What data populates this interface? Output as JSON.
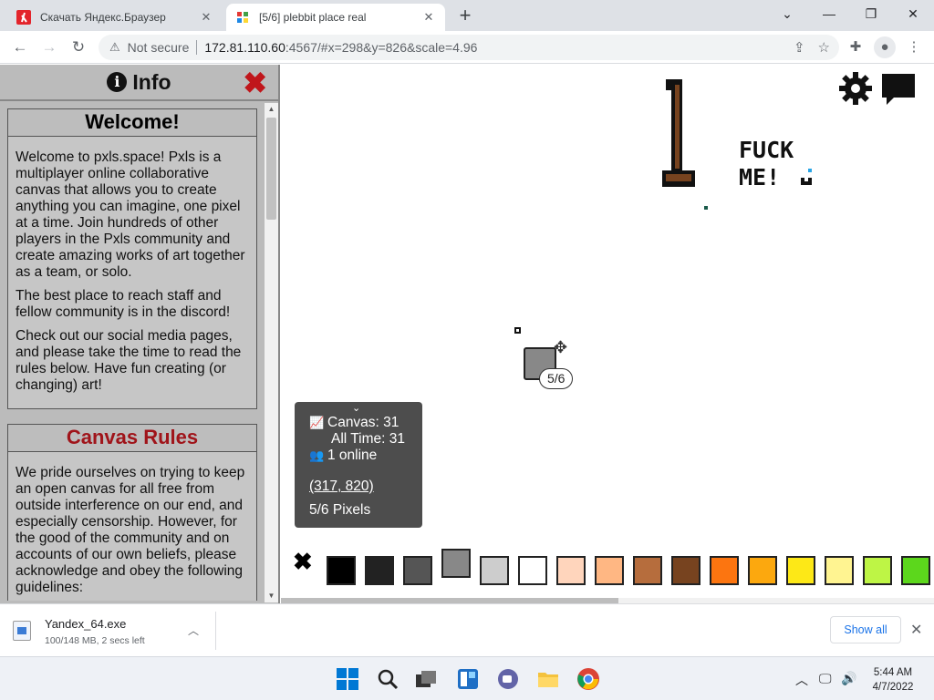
{
  "browser": {
    "tabs": [
      {
        "title": "Скачать Яндекс.Браузер",
        "active": false
      },
      {
        "title": "[5/6] plebbit place real",
        "active": true
      }
    ],
    "new_tab_glyph": "+",
    "address": {
      "security_label": "Not secure",
      "host": "172.81.110.60",
      "rest": ":4567/#x=298&y=826&scale=4.96"
    }
  },
  "info_panel": {
    "title": "Info",
    "welcome": {
      "heading": "Welcome!",
      "paragraphs": [
        "Welcome to pxls.space! Pxls is a multiplayer online collaborative canvas that allows you to create anything you can imagine, one pixel at a time. Join hundreds of other players in the Pxls community and create amazing works of art together as a team, or solo.",
        "The best place to reach staff and fellow community is in the discord!",
        "Check out our social media pages, and please take the time to read the rules below. Have fun creating (or changing) art!"
      ]
    },
    "rules": {
      "heading": "Canvas Rules",
      "paragraphs": [
        "We pride ourselves on trying to keep an open canvas for all free from outside interference on our end, and especially censorship. However, for the good of the community and on accounts of our own beliefs, please acknowledge and obey the following guidelines:"
      ]
    }
  },
  "canvas": {
    "art_text_line1": "FUCK",
    "art_text_line2": "ME!",
    "cooldown_badge": "5/6"
  },
  "stats": {
    "canvas_count": "Canvas: 31",
    "all_time": "All Time: 31",
    "online": "1 online",
    "coords": "(317, 820)",
    "pixels": "5/6 Pixels"
  },
  "palette": {
    "colors": [
      "#000000",
      "#222222",
      "#555555",
      "#888888",
      "#cdcdcd",
      "#ffffff",
      "#ffd5bc",
      "#ffb783",
      "#b66d3d",
      "#77431f",
      "#fc7510",
      "#fca80e",
      "#fde817",
      "#fff491",
      "#bef545",
      "#5cd71c"
    ],
    "selected_index": 3
  },
  "downloads": {
    "file_name": "Yandex_64.exe",
    "status": "100/148 MB, 2 secs left",
    "show_all": "Show all"
  },
  "taskbar": {
    "time": "5:44 AM",
    "date": "4/7/2022"
  },
  "colors": {
    "panel_bg": "#bbbbbb",
    "rules_red": "#a0141a",
    "close_red": "#c0161b",
    "stats_bg": "#4d4d4d",
    "link_blue": "#1a73e8"
  },
  "icons": [
    "yandex-favicon",
    "pxls-favicon",
    "close-icon",
    "plus-icon",
    "chevron-down-icon",
    "minimize-icon",
    "restore-icon",
    "back-arrow-icon",
    "forward-arrow-icon",
    "reload-icon",
    "warning-icon",
    "share-icon",
    "star-icon",
    "extensions-icon",
    "profile-icon",
    "menu-dots-icon",
    "info-icon",
    "gear-icon",
    "chat-icon",
    "move-cursor-icon",
    "chart-icon",
    "users-icon",
    "file-icon",
    "windows-start-icon",
    "search-icon",
    "task-view-icon",
    "widgets-icon",
    "teams-chat-icon",
    "folder-icon",
    "chrome-icon",
    "tray-chevron-icon",
    "network-icon",
    "volume-icon"
  ]
}
